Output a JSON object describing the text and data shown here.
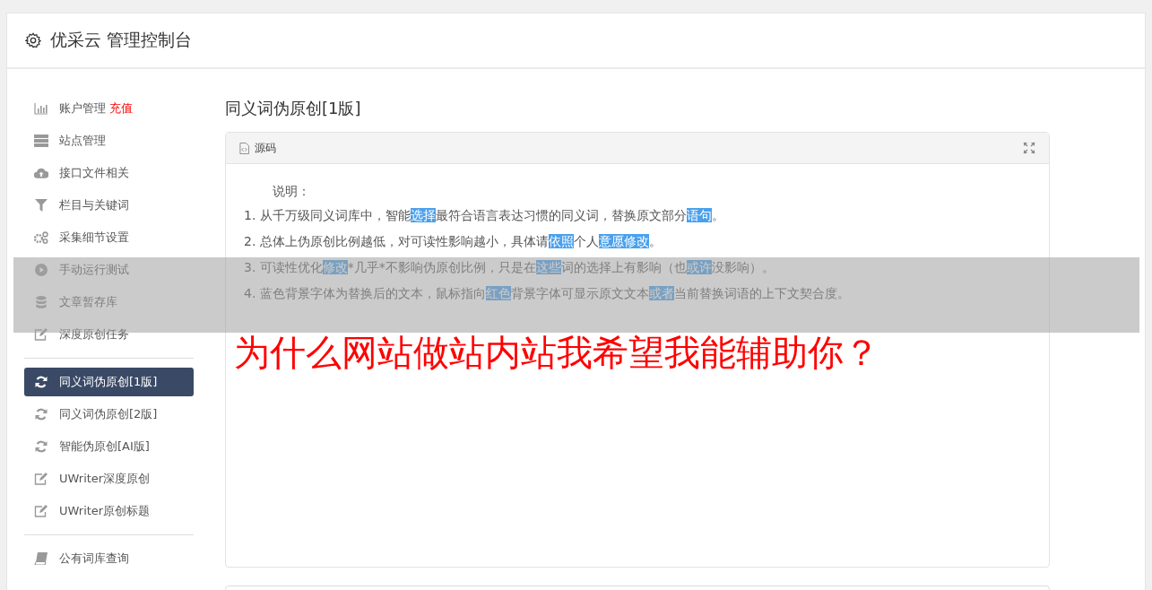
{
  "header": {
    "title": "优采云 管理控制台"
  },
  "sidebar": {
    "groups": [
      {
        "items": [
          {
            "kind": "chart",
            "label": "账户管理",
            "badge": "充值",
            "selected": false
          },
          {
            "kind": "server",
            "label": "站点管理",
            "selected": false
          },
          {
            "kind": "cloud",
            "label": "接口文件相关",
            "selected": false
          },
          {
            "kind": "filter",
            "label": "栏目与关键词",
            "selected": false
          },
          {
            "kind": "gears",
            "label": "采集细节设置",
            "selected": false
          },
          {
            "kind": "play",
            "label": "手动运行测试",
            "selected": false
          },
          {
            "kind": "database",
            "label": "文章暂存库",
            "selected": false
          },
          {
            "kind": "edit",
            "label": "深度原创任务",
            "selected": false
          }
        ]
      },
      {
        "items": [
          {
            "kind": "refresh",
            "label": "同义词伪原创[1版]",
            "selected": true
          },
          {
            "kind": "refresh",
            "label": "同义词伪原创[2版]",
            "selected": false
          },
          {
            "kind": "refresh",
            "label": "智能伪原创[AI版]",
            "selected": false
          },
          {
            "kind": "edit",
            "label": "UWriter深度原创",
            "selected": false
          },
          {
            "kind": "edit",
            "label": "UWriter原创标题",
            "selected": false
          }
        ]
      },
      {
        "items": [
          {
            "kind": "book",
            "label": "公有词库查询",
            "selected": false
          }
        ]
      }
    ]
  },
  "main": {
    "title": "同义词伪原创[1版]",
    "panel": {
      "tab": "源码",
      "heading": "说明：",
      "lines": [
        [
          {
            "text": "1. 从千万级同义词库中，智能",
            "highlighted": false
          },
          {
            "text": "选择",
            "highlighted": true
          },
          {
            "text": "最符合语言表达习惯的同义词，替换原文部分",
            "highlighted": false
          },
          {
            "text": "语句",
            "highlighted": true
          },
          {
            "text": "。",
            "highlighted": false
          }
        ],
        [
          {
            "text": "2. 总体上伪原创比例越低，对可读性影响越小，具体请",
            "highlighted": false
          },
          {
            "text": "依照",
            "highlighted": true
          },
          {
            "text": "个人",
            "highlighted": false
          },
          {
            "text": "意愿",
            "highlighted": true
          },
          {
            "text": "修改",
            "highlighted": true
          },
          {
            "text": "。",
            "highlighted": false
          }
        ],
        [
          {
            "text": "3. 可读性优化",
            "highlighted": false
          },
          {
            "text": "修改",
            "highlighted": true
          },
          {
            "text": "*几乎*不影响伪原创比例，只是在",
            "highlighted": false
          },
          {
            "text": "这些",
            "highlighted": true
          },
          {
            "text": "词的选择上有影响（也",
            "highlighted": false
          },
          {
            "text": "或许",
            "highlighted": true
          },
          {
            "text": "没影响）。",
            "highlighted": false
          }
        ],
        [
          {
            "text": "4. 蓝色背景字体为替换后的文本，鼠标指向",
            "highlighted": false
          },
          {
            "text": "红色",
            "highlighted": true
          },
          {
            "text": "背景字体可显示原文文本",
            "highlighted": false
          },
          {
            "text": "或者",
            "highlighted": true
          },
          {
            "text": "当前替换词语的上下文契合度。",
            "highlighted": false
          }
        ]
      ]
    }
  },
  "overlay": {
    "caption": "为什么网站做站内站我希望我能辅助你？"
  }
}
